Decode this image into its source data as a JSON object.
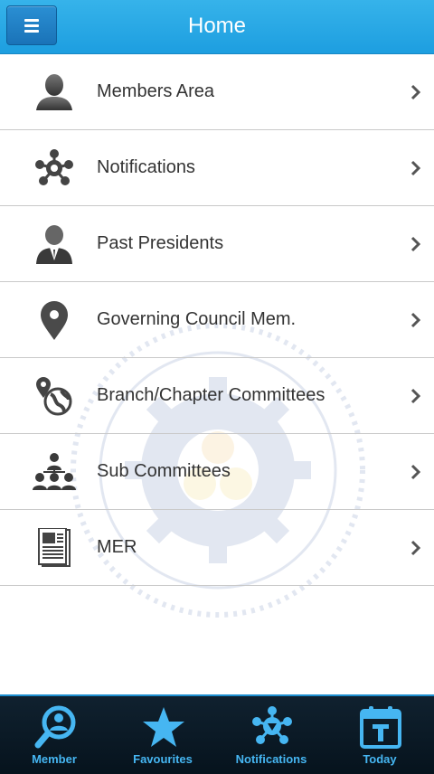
{
  "header": {
    "title": "Home",
    "menu_icon": "hamburger-icon"
  },
  "menu": [
    {
      "label": "Members Area",
      "icon": "person-icon"
    },
    {
      "label": "Notifications",
      "icon": "network-icon"
    },
    {
      "label": "Past Presidents",
      "icon": "businessman-icon"
    },
    {
      "label": "Governing Council Mem.",
      "icon": "map-pin-icon"
    },
    {
      "label": "Branch/Chapter Committees",
      "icon": "globe-pin-icon"
    },
    {
      "label": "Sub Committees",
      "icon": "org-chart-icon"
    },
    {
      "label": "MER",
      "icon": "newspaper-icon"
    }
  ],
  "tabs": [
    {
      "label": "Member",
      "icon": "search-person-icon"
    },
    {
      "label": "Favourites",
      "icon": "star-icon"
    },
    {
      "label": "Notifications",
      "icon": "network-icon"
    },
    {
      "label": "Today",
      "icon": "calendar-icon"
    }
  ],
  "colors": {
    "accent": "#1d9ee0",
    "tab_text": "#46b6f2",
    "tabbar_bg": "#0b1a26"
  }
}
